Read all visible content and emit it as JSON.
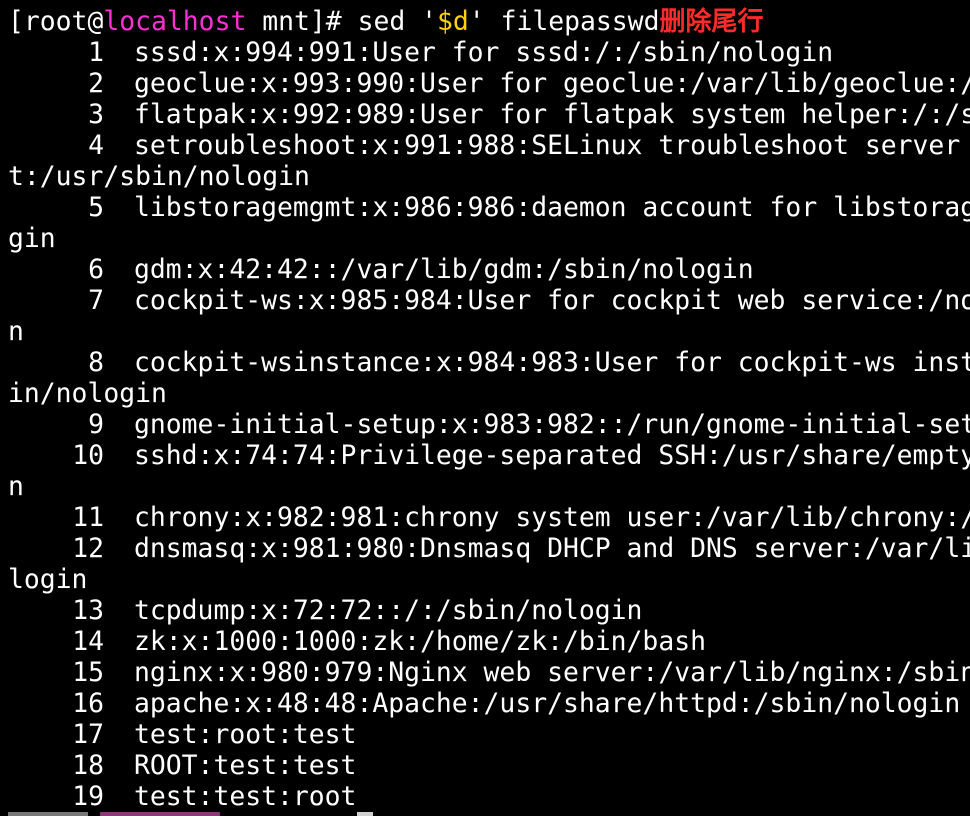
{
  "prompt": {
    "open": "[root@",
    "host": "localhost",
    "close": " mnt]# sed '",
    "expr": "$d",
    "tail": "' filepasswd",
    "annotation": "删除尾行"
  },
  "lines": [
    {
      "num": "1",
      "text": "sssd:x:994:991:User for sssd:/:/sbin/nologin"
    },
    {
      "num": "2",
      "text": "geoclue:x:993:990:User for geoclue:/var/lib/geoclue:/"
    },
    {
      "num": "3",
      "text": "flatpak:x:992:989:User for flatpak system helper:/:/s"
    },
    {
      "num": "4",
      "text": "setroubleshoot:x:991:988:SELinux troubleshoot server",
      "cont": "t:/usr/sbin/nologin"
    },
    {
      "num": "5",
      "text": "libstoragemgmt:x:986:986:daemon account for libstorag",
      "cont": "gin"
    },
    {
      "num": "6",
      "text": "gdm:x:42:42::/var/lib/gdm:/sbin/nologin"
    },
    {
      "num": "7",
      "text": "cockpit-ws:x:985:984:User for cockpit web service:/no",
      "cont": "n"
    },
    {
      "num": "8",
      "text": "cockpit-wsinstance:x:984:983:User for cockpit-ws inst",
      "cont": "in/nologin"
    },
    {
      "num": "9",
      "text": "gnome-initial-setup:x:983:982::/run/gnome-initial-set"
    },
    {
      "num": "10",
      "text": "sshd:x:74:74:Privilege-separated SSH:/usr/share/empty",
      "cont": "n"
    },
    {
      "num": "11",
      "text": "chrony:x:982:981:chrony system user:/var/lib/chrony:/"
    },
    {
      "num": "12",
      "text": "dnsmasq:x:981:980:Dnsmasq DHCP and DNS server:/var/li",
      "cont": "login"
    },
    {
      "num": "13",
      "text": "tcpdump:x:72:72::/:/sbin/nologin"
    },
    {
      "num": "14",
      "text": "zk:x:1000:1000:zk:/home/zk:/bin/bash"
    },
    {
      "num": "15",
      "text": "nginx:x:980:979:Nginx web server:/var/lib/nginx:/sbin"
    },
    {
      "num": "16",
      "text": "apache:x:48:48:Apache:/usr/share/httpd:/sbin/nologin"
    },
    {
      "num": "17",
      "text": "test:root:test"
    },
    {
      "num": "18",
      "text": "ROOT:test:test"
    },
    {
      "num": "19",
      "text": "test:test:root"
    }
  ],
  "colors": {
    "background": "#000000",
    "text": "#ffffff",
    "host": "#ff2fd4",
    "quoted": "#ffd400",
    "annotation": "#ff2a2a"
  }
}
